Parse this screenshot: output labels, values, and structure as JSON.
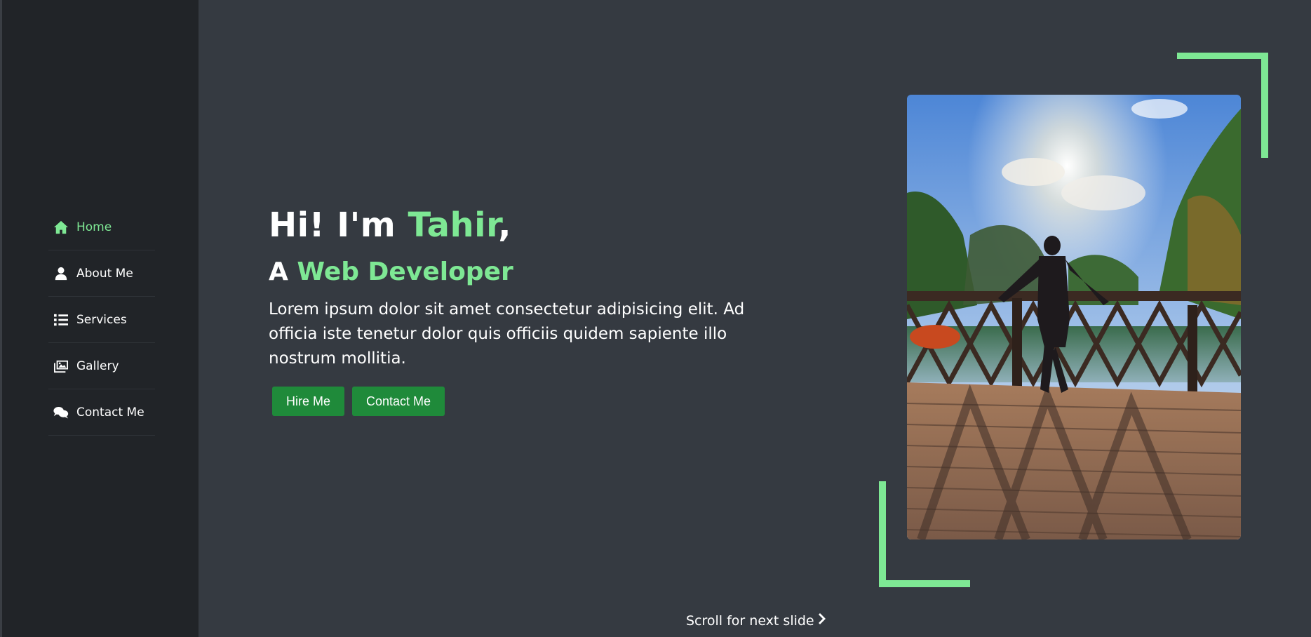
{
  "sidebar": {
    "items": [
      {
        "label": "Home",
        "icon": "home-icon",
        "active": true
      },
      {
        "label": "About Me",
        "icon": "user-icon",
        "active": false
      },
      {
        "label": "Services",
        "icon": "list-icon",
        "active": false
      },
      {
        "label": "Gallery",
        "icon": "images-icon",
        "active": false
      },
      {
        "label": "Contact Me",
        "icon": "comments-icon",
        "active": false
      }
    ]
  },
  "hero": {
    "greeting_prefix": "Hi! I'm ",
    "name": "Tahir",
    "greeting_suffix": ",",
    "role_prefix": "A ",
    "role": "Web Developer",
    "description": "Lorem ipsum dolor sit amet consectetur adipisicing elit. Ad officia iste tenetur dolor quis officiis quidem sapiente illo nostrum mollitia.",
    "hire_button": "Hire Me",
    "contact_button": "Contact Me"
  },
  "scroll_hint": "Scroll for next slide",
  "colors": {
    "accent": "#7ee894",
    "button": "#1f8a3a",
    "background": "#353a41",
    "sidebar": "#212428"
  }
}
